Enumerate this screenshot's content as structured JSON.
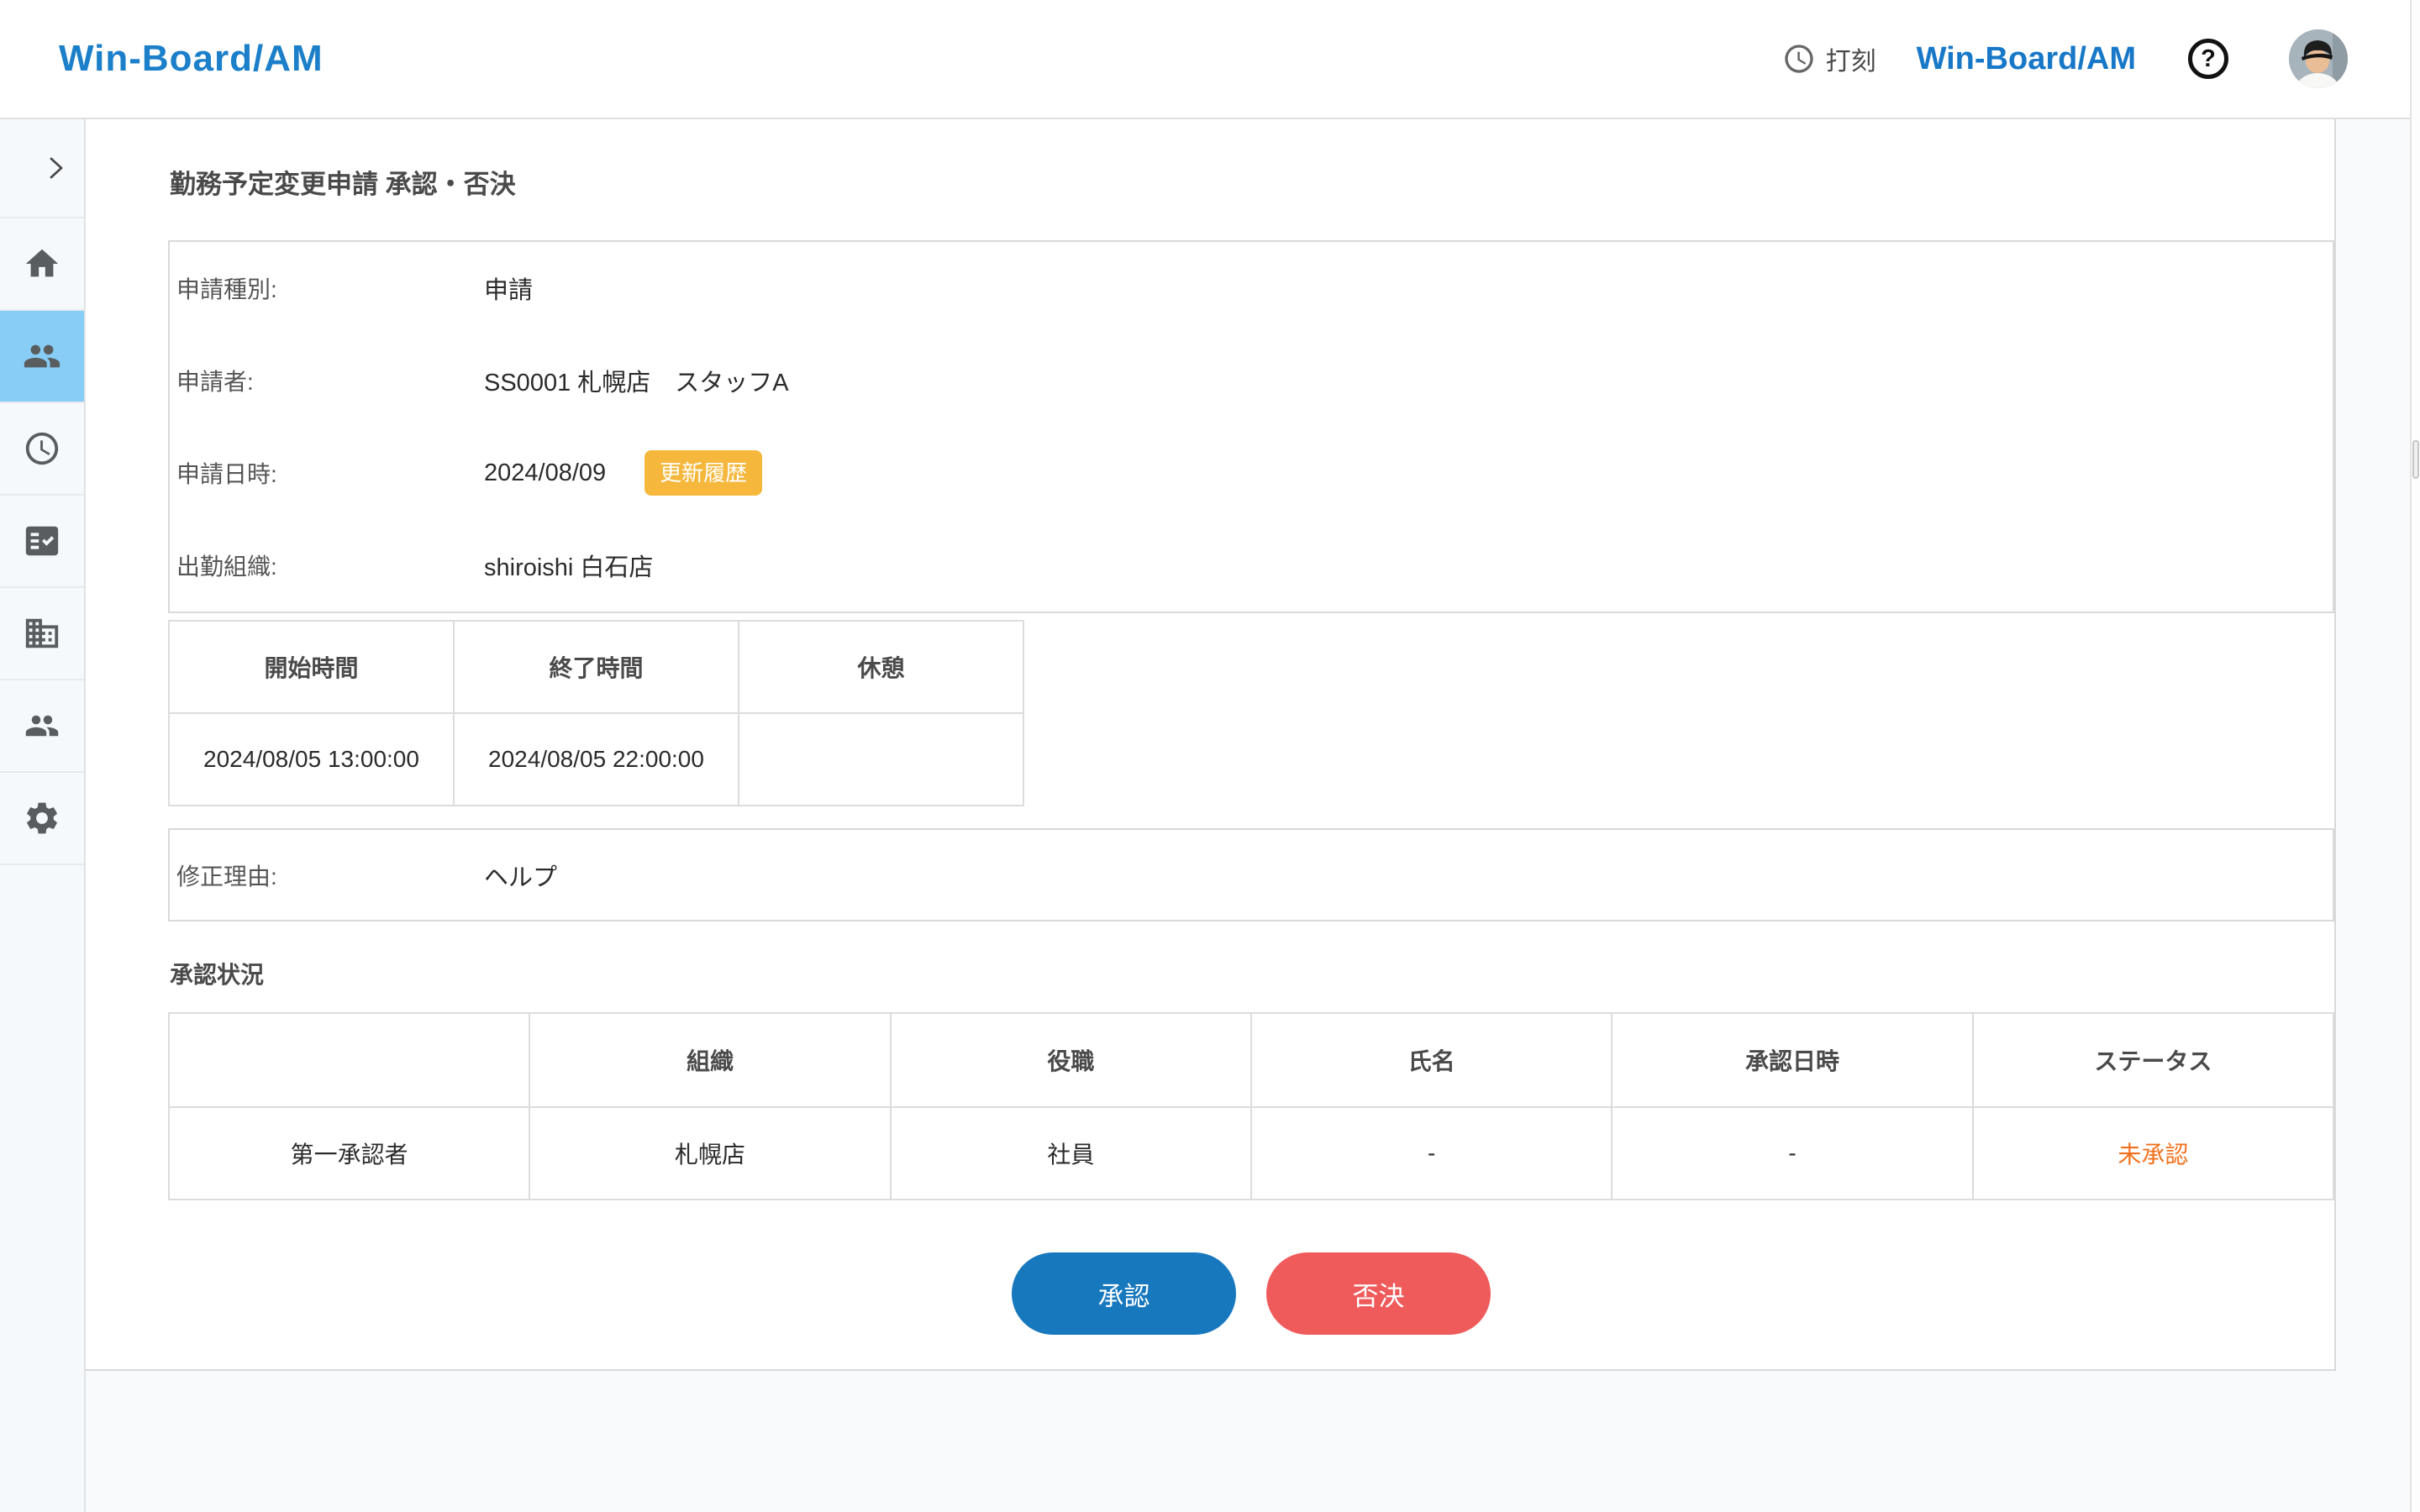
{
  "header": {
    "logo": "Win-Board/AM",
    "punch": {
      "icon": "clock-icon",
      "label": "打刻"
    },
    "product": "Win-Board/AM",
    "help_glyph": "?",
    "avatar": "user-photo-avatar"
  },
  "sidebar": {
    "active_index": 2,
    "items": [
      {
        "icon": "chevron-right-icon"
      },
      {
        "icon": "home-icon"
      },
      {
        "icon": "people-icon"
      },
      {
        "icon": "clock-icon"
      },
      {
        "icon": "fact-check-icon"
      },
      {
        "icon": "building-icon"
      },
      {
        "icon": "people-alt-icon"
      },
      {
        "icon": "settings-icon"
      }
    ]
  },
  "main": {
    "title": "勤務予定変更申請 承認・否決",
    "request_fields": [
      {
        "label": "申請種別:",
        "value": "申請"
      },
      {
        "label": "申請者:",
        "value": "SS0001 札幌店　スタッフA"
      },
      {
        "label": "申請日時:",
        "value": "2024/08/09",
        "badge": "更新履歴"
      },
      {
        "label": "出勤組織:",
        "value": "shiroishi 白石店"
      }
    ],
    "schedule_table": {
      "headers": [
        "開始時間",
        "終了時間",
        "休憩"
      ],
      "rows": [
        [
          "2024/08/05 13:00:00",
          "2024/08/05 22:00:00",
          ""
        ]
      ]
    },
    "reason": {
      "label": "修正理由:",
      "value": "ヘルプ"
    },
    "approval": {
      "heading": "承認状況",
      "headers": [
        "",
        "組織",
        "役職",
        "氏名",
        "承認日時",
        "ステータス"
      ],
      "rows": [
        [
          "第一承認者",
          "札幌店",
          "社員",
          "-",
          "-",
          "未承認"
        ]
      ]
    },
    "actions": {
      "approve": "承認",
      "reject": "否決"
    }
  },
  "colors": {
    "brand_blue": "#1b7fc9",
    "sidebar_active_bg": "#87cdf5",
    "badge_amber": "#f5b83d",
    "status_orange": "#f2711c",
    "approve_blue": "#1878be",
    "reject_red": "#ef5b5b"
  }
}
